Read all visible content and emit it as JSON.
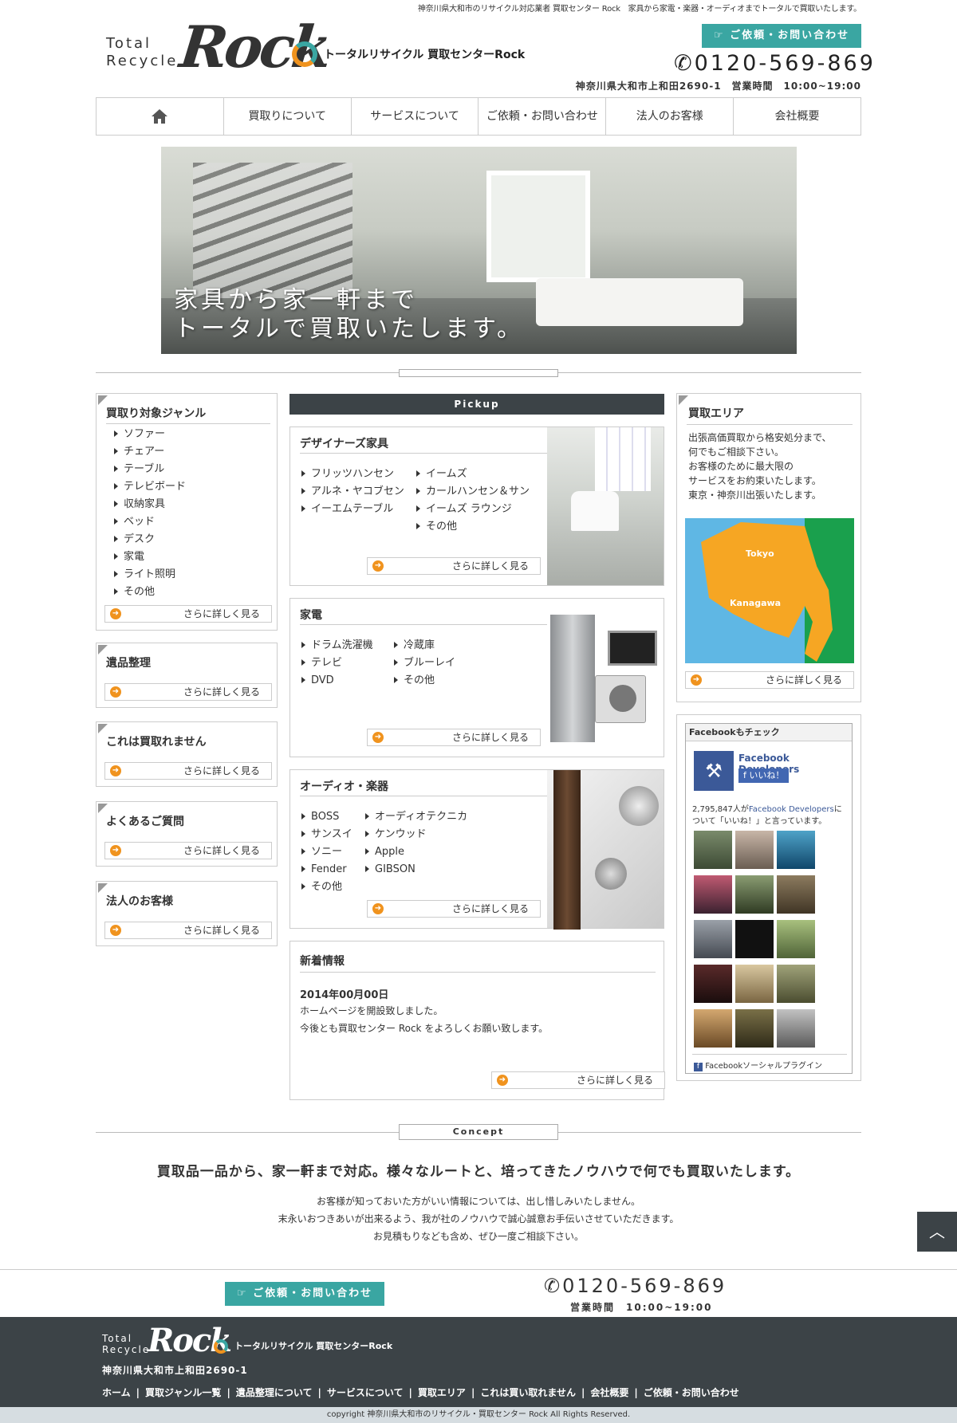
{
  "header": {
    "topline": "神奈川県大和市のリサイクル対応業者 買取センター Rock　家具から家電・楽器・オーディオまでトータルで買取いたします。",
    "logo_en_line1": "Total",
    "logo_en_line2": "Recycle",
    "logo_rock": "Rock",
    "logo_sub": "トータルリサイクル 買取センターRock",
    "contact_button": "ご依頼・お問い合わせ",
    "tel": "0120-569-869",
    "address_hours": "神奈川県大和市上和田2690-1　営業時間　10:00~19:00"
  },
  "nav": {
    "home_icon": "home-icon",
    "items": [
      "買取りについて",
      "サービスについて",
      "ご依頼・お問い合わせ",
      "法人のお客様",
      "会社概要"
    ]
  },
  "hero": {
    "line1": "家具から家一軒まで",
    "line2": "トータルで買取いたします。"
  },
  "sidebar_left": {
    "genre_title": "買取り対象ジャンル",
    "genres": [
      "ソファー",
      "チェアー",
      "テーブル",
      "テレビボード",
      "収納家具",
      "ベッド",
      "デスク",
      "家電",
      "ライト照明",
      "その他"
    ],
    "more": "さらに詳しく見る",
    "boxes": [
      {
        "title": "遺品整理",
        "more": "さらに詳しく見る"
      },
      {
        "title": "これは買取れません",
        "more": "さらに詳しく見る"
      },
      {
        "title": "よくあるご質問",
        "more": "さらに詳しく見る"
      },
      {
        "title": "法人のお客様",
        "more": "さらに詳しく見る"
      }
    ]
  },
  "pickup": {
    "label": "Pickup",
    "cards": [
      {
        "title": "デザイナーズ家具",
        "col1": [
          "フリッツハンセン",
          "アルネ・ヤコブセン",
          "イーエムテーブル"
        ],
        "col2": [
          "イームズ",
          "カールハンセン＆サン",
          "イームズ ラウンジ",
          "その他"
        ],
        "more": "さらに詳しく見る"
      },
      {
        "title": "家電",
        "col1": [
          "ドラム洗濯機",
          "テレビ",
          "DVD"
        ],
        "col2": [
          "冷蔵庫",
          "ブルーレイ",
          "その他"
        ],
        "more": "さらに詳しく見る"
      },
      {
        "title": "オーディオ・楽器",
        "col1": [
          "BOSS",
          "サンスイ",
          "ソニー",
          "Fender",
          "その他"
        ],
        "col2": [
          "オーディオテクニカ",
          "ケンウッド",
          "Apple",
          "GIBSON"
        ],
        "more": "さらに詳しく見る"
      }
    ]
  },
  "news": {
    "title": "新着情報",
    "date": "2014年00月00日",
    "line1": "ホームページを開設致しました。",
    "line2": "今後とも買取センター Rock をよろしくお願い致します。",
    "more": "さらに詳しく見る"
  },
  "area": {
    "title": "買取エリア",
    "text": [
      "出張高価買取から格安処分まで、",
      "何でもご相談下さい。",
      "お客様のために最大限の",
      "サービスをお約束いたします。",
      "東京・神奈川出張いたします。"
    ],
    "map_tokyo": "Tokyo",
    "map_kanagawa": "Kanagawa",
    "more": "さらに詳しく見る"
  },
  "facebook": {
    "header": "Facebookもチェック",
    "page_name": "Facebook Developers",
    "like_button": "いいね！",
    "count_prefix": "2,795,847人が",
    "count_link": "Facebook Developers",
    "count_suffix": "に",
    "count_line2": "ついて「いいね！」と言っています。",
    "plugin": "Facebookソーシャルプラグイン"
  },
  "concept": {
    "label": "Concept",
    "heading": "買取品一品から、家一軒まで対応。様々なルートと、培ってきたノウハウで何でも買取いたします。",
    "lines": [
      "お客様が知っておいた方がいい情報については、出し惜しみいたしません。",
      "末永いおつきあいが出来るよう、我が社のノウハウで誠心誠意お手伝いさせていただきます。",
      "お見積もりなども含め、ぜひ一度ご相談下さい。"
    ]
  },
  "footer_bar": {
    "contact_button": "ご依頼・お問い合わせ",
    "tel": "0120-569-869",
    "hours": "営業時間　10:00~19:00"
  },
  "footer": {
    "logo_en_line1": "Total",
    "logo_en_line2": "Recycle",
    "logo_rock": "Rock",
    "logo_sub": "トータルリサイクル 買取センターRock",
    "address": "神奈川県大和市上和田2690-1",
    "links": [
      "ホーム",
      "買取ジャンル一覧",
      "遺品整理について",
      "サービスについて",
      "買取エリア",
      "これは買い取れません",
      "会社概要",
      "ご依頼・お問い合わせ"
    ],
    "copyright": "copyright 神奈川県大和市のリサイクル・買取センター Rock All Rights Reserved."
  }
}
